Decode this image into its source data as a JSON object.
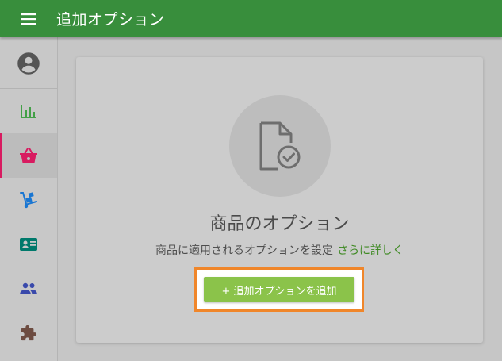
{
  "header": {
    "title": "追加オプション"
  },
  "sidebar": {
    "items": [
      {
        "icon": "account-circle-icon",
        "color": "#555555"
      },
      {
        "icon": "bar-chart-icon",
        "color": "#43a047"
      },
      {
        "icon": "basket-icon",
        "color": "#d81b60",
        "active": true
      },
      {
        "icon": "hand-truck-icon",
        "color": "#1976d2"
      },
      {
        "icon": "contact-card-icon",
        "color": "#00796b"
      },
      {
        "icon": "people-icon",
        "color": "#3949ab"
      },
      {
        "icon": "puzzle-icon",
        "color": "#6d4c41"
      }
    ]
  },
  "empty_state": {
    "icon": "file-check-icon",
    "title": "商品のオプション",
    "description": "商品に適用されるオプションを設定",
    "link_label": "さらに詳しく",
    "button_label": "+ 追加オプションを追加"
  },
  "colors": {
    "header": "#388e3c",
    "accent": "#8bc34a",
    "link": "#3f8a24",
    "highlight": "#f0862a",
    "active_indicator": "#d81b60"
  }
}
